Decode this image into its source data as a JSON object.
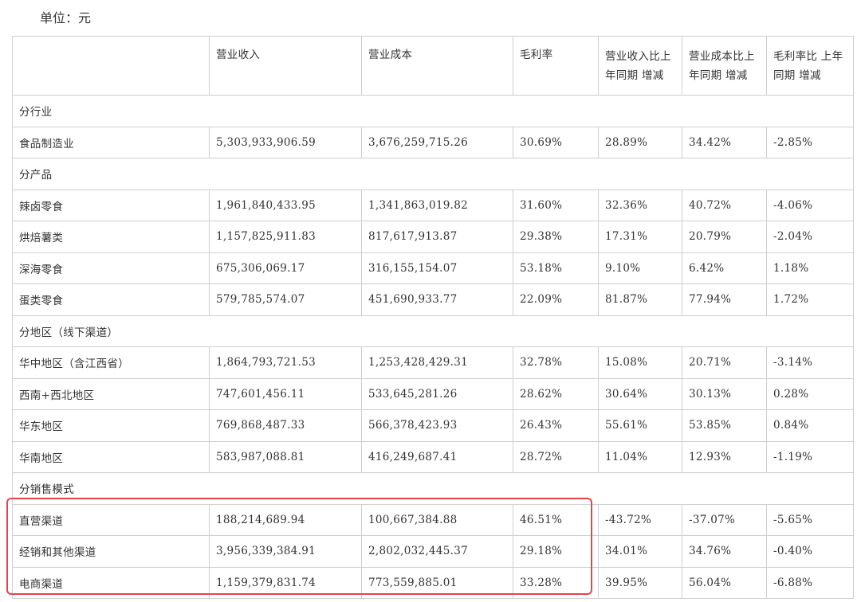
{
  "unit_label": "单位：元",
  "headers": [
    "",
    "营业收入",
    "营业成本",
    "毛利率",
    "营业收入比上年同期 增减",
    "营业成本比上年同期 增减",
    "毛利率比 上年同期 增减"
  ],
  "sections": [
    {
      "title": "分行业",
      "rows": [
        {
          "name": "食品制造业",
          "cells": [
            "5,303,933,906.59",
            "3,676,259,715.26",
            "30.69%",
            "28.89%",
            "34.42%",
            "-2.85%"
          ]
        }
      ]
    },
    {
      "title": "分产品",
      "rows": [
        {
          "name": "辣卤零食",
          "cells": [
            "1,961,840,433.95",
            "1,341,863,019.82",
            "31.60%",
            "32.36%",
            "40.72%",
            "-4.06%"
          ]
        },
        {
          "name": "烘焙薯类",
          "cells": [
            "1,157,825,911.83",
            "817,617,913.87",
            "29.38%",
            "17.31%",
            "20.79%",
            "-2.04%"
          ]
        },
        {
          "name": "深海零食",
          "cells": [
            "675,306,069.17",
            "316,155,154.07",
            "53.18%",
            "9.10%",
            "6.42%",
            "1.18%"
          ]
        },
        {
          "name": "蛋类零食",
          "cells": [
            "579,785,574.07",
            "451,690,933.77",
            "22.09%",
            "81.87%",
            "77.94%",
            "1.72%"
          ]
        }
      ]
    },
    {
      "title": "分地区（线下渠道）",
      "rows": [
        {
          "name": "华中地区（含江西省）",
          "cells": [
            "1,864,793,721.53",
            "1,253,428,429.31",
            "32.78%",
            "15.08%",
            "20.71%",
            "-3.14%"
          ]
        },
        {
          "name": "西南+西北地区",
          "cells": [
            "747,601,456.11",
            "533,645,281.26",
            "28.62%",
            "30.64%",
            "30.13%",
            "0.28%"
          ]
        },
        {
          "name": "华东地区",
          "cells": [
            "769,868,487.33",
            "566,378,423.93",
            "26.43%",
            "55.61%",
            "53.85%",
            "0.84%"
          ]
        },
        {
          "name": "华南地区",
          "cells": [
            "583,987,088.81",
            "416,249,687.41",
            "28.72%",
            "11.04%",
            "12.93%",
            "-1.19%"
          ]
        }
      ]
    },
    {
      "title": "分销售模式",
      "rows": [
        {
          "name": "直营渠道",
          "cells": [
            "188,214,689.94",
            "100,667,384.88",
            "46.51%",
            "-43.72%",
            "-37.07%",
            "-5.65%"
          ]
        },
        {
          "name": "经销和其他渠道",
          "cells": [
            "3,956,339,384.91",
            "2,802,032,445.37",
            "29.18%",
            "34.01%",
            "34.76%",
            "-0.40%"
          ]
        },
        {
          "name": "电商渠道",
          "cells": [
            "1,159,379,831.74",
            "773,559,885.01",
            "33.28%",
            "39.95%",
            "56.04%",
            "-6.88%"
          ]
        }
      ]
    }
  ],
  "highlight_color": "#e8424e"
}
